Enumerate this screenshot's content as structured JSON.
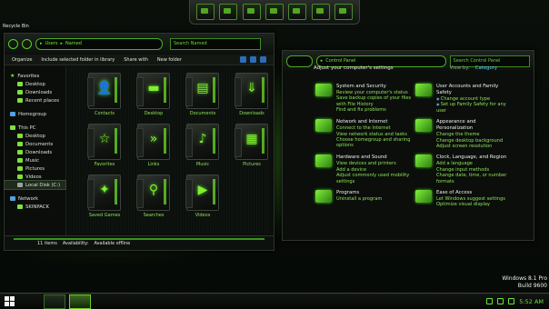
{
  "desktop": {
    "recycle_bin": "Recycle Bin",
    "watermark_line1": "Windows 8.1 Pro",
    "watermark_line2": "Build 9600"
  },
  "explorer": {
    "breadcrumb": [
      "Users",
      "Named"
    ],
    "search_placeholder": "Search Named",
    "toolbar": {
      "organize": "Organize",
      "include_library": "Include selected folder in library",
      "share_with": "Share with",
      "new_folder": "New folder"
    },
    "nav": {
      "favorites": {
        "label": "Favorites",
        "items": [
          "Desktop",
          "Downloads",
          "Recent places"
        ]
      },
      "homegroup": "Homegroup",
      "this_pc": {
        "label": "This PC",
        "items": [
          "Desktop",
          "Documents",
          "Downloads",
          "Music",
          "Pictures",
          "Videos",
          "Local Disk (C:)"
        ]
      },
      "network": {
        "label": "Network",
        "items": [
          "SKINPACK"
        ]
      }
    },
    "folders": [
      {
        "label": "Contacts",
        "glyph": "👤"
      },
      {
        "label": "Desktop",
        "glyph": "▬"
      },
      {
        "label": "Documents",
        "glyph": "▤"
      },
      {
        "label": "Downloads",
        "glyph": "⇓"
      },
      {
        "label": "Favorites",
        "glyph": "☆"
      },
      {
        "label": "Links",
        "glyph": "»"
      },
      {
        "label": "Music",
        "glyph": "♪"
      },
      {
        "label": "Pictures",
        "glyph": "▦"
      },
      {
        "label": "Saved Games",
        "glyph": "✦"
      },
      {
        "label": "Searches",
        "glyph": "⚲"
      },
      {
        "label": "Videos",
        "glyph": "▶"
      }
    ],
    "status": {
      "count": "11 items",
      "availability_label": "Availability:",
      "availability_value": "Available offline"
    }
  },
  "control_panel": {
    "breadcrumb": "Control Panel",
    "search_placeholder": "Search Control Panel",
    "heading": "Adjust your computer's settings",
    "view_by_label": "View by:",
    "view_by_value": "Category",
    "left_categories": [
      {
        "title": "System and Security",
        "links": [
          "Review your computer's status",
          "Save backup copies of your files with File History",
          "Find and fix problems"
        ]
      },
      {
        "title": "Network and Internet",
        "links": [
          "Connect to the Internet",
          "View network status and tasks",
          "Choose homegroup and sharing options"
        ]
      },
      {
        "title": "Hardware and Sound",
        "links": [
          "View devices and printers",
          "Add a device",
          "Adjust commonly used mobility settings"
        ]
      },
      {
        "title": "Programs",
        "links": [
          "Uninstall a program"
        ]
      }
    ],
    "right_categories": [
      {
        "title": "User Accounts and Family Safety",
        "links": [
          "Change account type",
          "Set up Family Safety for any user"
        ]
      },
      {
        "title": "Appearance and Personalization",
        "links": [
          "Change the theme",
          "Change desktop background",
          "Adjust screen resolution"
        ]
      },
      {
        "title": "Clock, Language, and Region",
        "links": [
          "Add a language",
          "Change input methods",
          "Change date, time, or number formats"
        ]
      },
      {
        "title": "Ease of Access",
        "links": [
          "Let Windows suggest settings",
          "Optimize visual display"
        ]
      }
    ]
  },
  "taskbar": {
    "clock": "5:52 AM"
  }
}
